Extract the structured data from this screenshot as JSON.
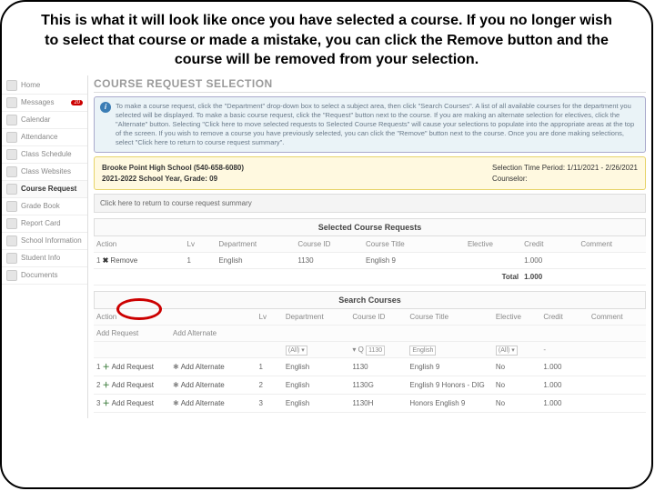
{
  "heading": "This is what it will look like once you have selected a course. If you no longer wish to select that course or made a mistake, you can click the Remove button and the course will be removed from your selection.",
  "sidebar": {
    "items": [
      {
        "label": "Home"
      },
      {
        "label": "Messages",
        "badge": "20"
      },
      {
        "label": "Calendar"
      },
      {
        "label": "Attendance"
      },
      {
        "label": "Class Schedule"
      },
      {
        "label": "Class Websites"
      },
      {
        "label": "Course Request",
        "active": true
      },
      {
        "label": "Grade Book"
      },
      {
        "label": "Report Card"
      },
      {
        "label": "School Information"
      },
      {
        "label": "Student Info"
      },
      {
        "label": "Documents"
      }
    ]
  },
  "page_title": "COURSE REQUEST SELECTION",
  "info_text": "To make a course request, click the \"Department\" drop-down box to select a subject area, then click \"Search Courses\". A list of all available courses for the department you selected will be displayed. To make a basic course request, click the \"Request\" button next to the course. If you are making an alternate selection for electives, click the \"Alternate\" button. Selecting \"Click here to move selected requests to Selected Course Requests\" will cause your selections to populate into the appropriate areas at the top of the screen. If you wish to remove a course you have previously selected, you can click the \"Remove\" button next to the course. Once you are done making selections, select \"Click here to return to course request summary\".",
  "school": {
    "name_phone": "Brooke Point High School (540-658-6080)",
    "year_grade": "2021-2022 School Year, Grade: 09",
    "period_label": "Selection Time Period:",
    "period_value": "1/11/2021 - 2/26/2021",
    "counselor_label": "Counselor:"
  },
  "return_link": "Click here to return to course request summary",
  "selected": {
    "title": "Selected Course Requests",
    "headers": {
      "action": "Action",
      "lv": "Lv",
      "department": "Department",
      "course_id": "Course ID",
      "course_title": "Course Title",
      "elective": "Elective",
      "credit": "Credit",
      "comment": "Comment"
    },
    "rows": [
      {
        "action": "Remove",
        "lv": "1",
        "department": "English",
        "course_id": "1130",
        "course_title": "English 9",
        "elective": "",
        "credit": "1.000",
        "comment": ""
      }
    ],
    "total_label": "Total",
    "total_credit": "1.000"
  },
  "search": {
    "title": "Search Courses",
    "headers": {
      "action": "Action",
      "lv": "Lv",
      "department": "Department",
      "course_id": "Course ID",
      "course_title": "Course Title",
      "elective": "Elective",
      "credit": "Credit",
      "comment": "Comment"
    },
    "add_request": "Add Request",
    "add_alternate": "Add Alternate",
    "filters": {
      "dept": "(All)",
      "cid_sym": "Q",
      "cid": "1130",
      "ctitle": "English",
      "elective": "(All)"
    },
    "rows": [
      {
        "lv": "1",
        "department": "English",
        "course_id": "1130",
        "course_title": "English 9",
        "elective": "No",
        "credit": "1.000"
      },
      {
        "lv": "2",
        "department": "English",
        "course_id": "1130G",
        "course_title": "English 9 Honors - DIG",
        "elective": "No",
        "credit": "1.000"
      },
      {
        "lv": "3",
        "department": "English",
        "course_id": "1130H",
        "course_title": "Honors English 9",
        "elective": "No",
        "credit": "1.000"
      }
    ]
  }
}
